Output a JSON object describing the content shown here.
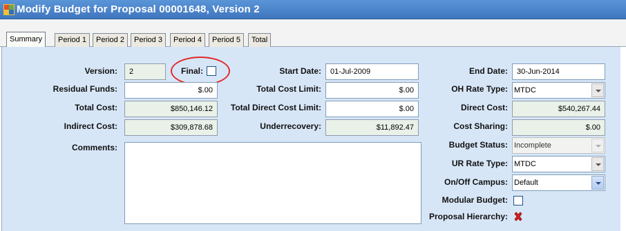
{
  "window": {
    "title": "Modify Budget for Proposal 00001648, Version 2"
  },
  "tabs": [
    "Summary",
    "Period 1",
    "Period 2",
    "Period 3",
    "Period 4",
    "Period 5",
    "Total"
  ],
  "form": {
    "version": {
      "label": "Version:",
      "value": "2"
    },
    "final": {
      "label": "Final:",
      "checked": false
    },
    "start_date": {
      "label": "Start Date:",
      "value": "01-Jul-2009"
    },
    "end_date": {
      "label": "End Date:",
      "value": "30-Jun-2014"
    },
    "residual_funds": {
      "label": "Residual Funds:",
      "value": "$.00"
    },
    "total_cost_limit": {
      "label": "Total Cost Limit:",
      "value": "$.00"
    },
    "oh_rate_type": {
      "label": "OH Rate Type:",
      "value": "MTDC"
    },
    "total_cost": {
      "label": "Total Cost:",
      "value": "$850,146.12"
    },
    "total_direct_cost_limit": {
      "label": "Total Direct Cost Limit:",
      "value": "$.00"
    },
    "direct_cost": {
      "label": "Direct Cost:",
      "value": "$540,267.44"
    },
    "indirect_cost": {
      "label": "Indirect Cost:",
      "value": "$309,878.68"
    },
    "underrecovery": {
      "label": "Underrecovery:",
      "value": "$11,892.47"
    },
    "cost_sharing": {
      "label": "Cost Sharing:",
      "value": "$.00"
    },
    "comments": {
      "label": "Comments:",
      "value": ""
    },
    "budget_status": {
      "label": "Budget Status:",
      "value": "Incomplete"
    },
    "ur_rate_type": {
      "label": "UR Rate Type:",
      "value": "MTDC"
    },
    "on_off_campus": {
      "label": "On/Off Campus:",
      "value": "Default"
    },
    "modular_budget": {
      "label": "Modular Budget:",
      "checked": false
    },
    "proposal_hierarchy": {
      "label": "Proposal Hierarchy:",
      "icon": "red-x-icon"
    }
  },
  "colors": {
    "titlebar": "#3f76bf",
    "panel": "#d7e6f7",
    "readonly_field": "#e9f1e9",
    "highlight_circle": "#e12b2b"
  }
}
